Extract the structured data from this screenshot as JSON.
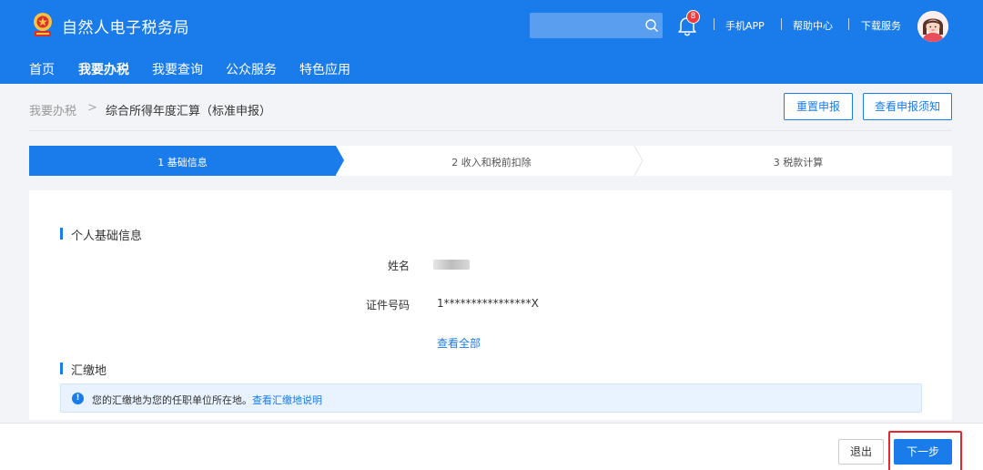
{
  "header": {
    "title": "自然人电子税务局",
    "logo_icon": "emblem-icon",
    "search": {
      "placeholder": ""
    },
    "notifications": {
      "count": "8"
    },
    "links": [
      "手机APP",
      "帮助中心",
      "下载服务"
    ],
    "nav": [
      {
        "label": "首页",
        "active": false
      },
      {
        "label": "我要办税",
        "active": true
      },
      {
        "label": "我要查询",
        "active": false
      },
      {
        "label": "公众服务",
        "active": false
      },
      {
        "label": "特色应用",
        "active": false
      }
    ]
  },
  "breadcrumb": {
    "parent": "我要办税",
    "separator": ">",
    "current": "综合所得年度汇算（标准申报）"
  },
  "actions": {
    "reset": "重置申报",
    "notice": "查看申报须知"
  },
  "steps": [
    {
      "label": "1 基础信息",
      "active": true
    },
    {
      "label": "2 收入和税前扣除",
      "active": false
    },
    {
      "label": "3 税款计算",
      "active": false
    }
  ],
  "personal": {
    "section_title": "个人基础信息",
    "name_label": "姓名",
    "id_label": "证件号码",
    "id_value": "1****************X",
    "view_all": "查看全部"
  },
  "payment_location": {
    "section_title": "汇缴地",
    "notice_text": "您的汇缴地为您的任职单位所在地。",
    "notice_link": "查看汇缴地说明"
  },
  "footer": {
    "exit": "退出",
    "next": "下一步"
  },
  "colors": {
    "primary": "#1a7bea",
    "highlight": "#e8262e",
    "notice_bg": "#e8f3ff"
  }
}
